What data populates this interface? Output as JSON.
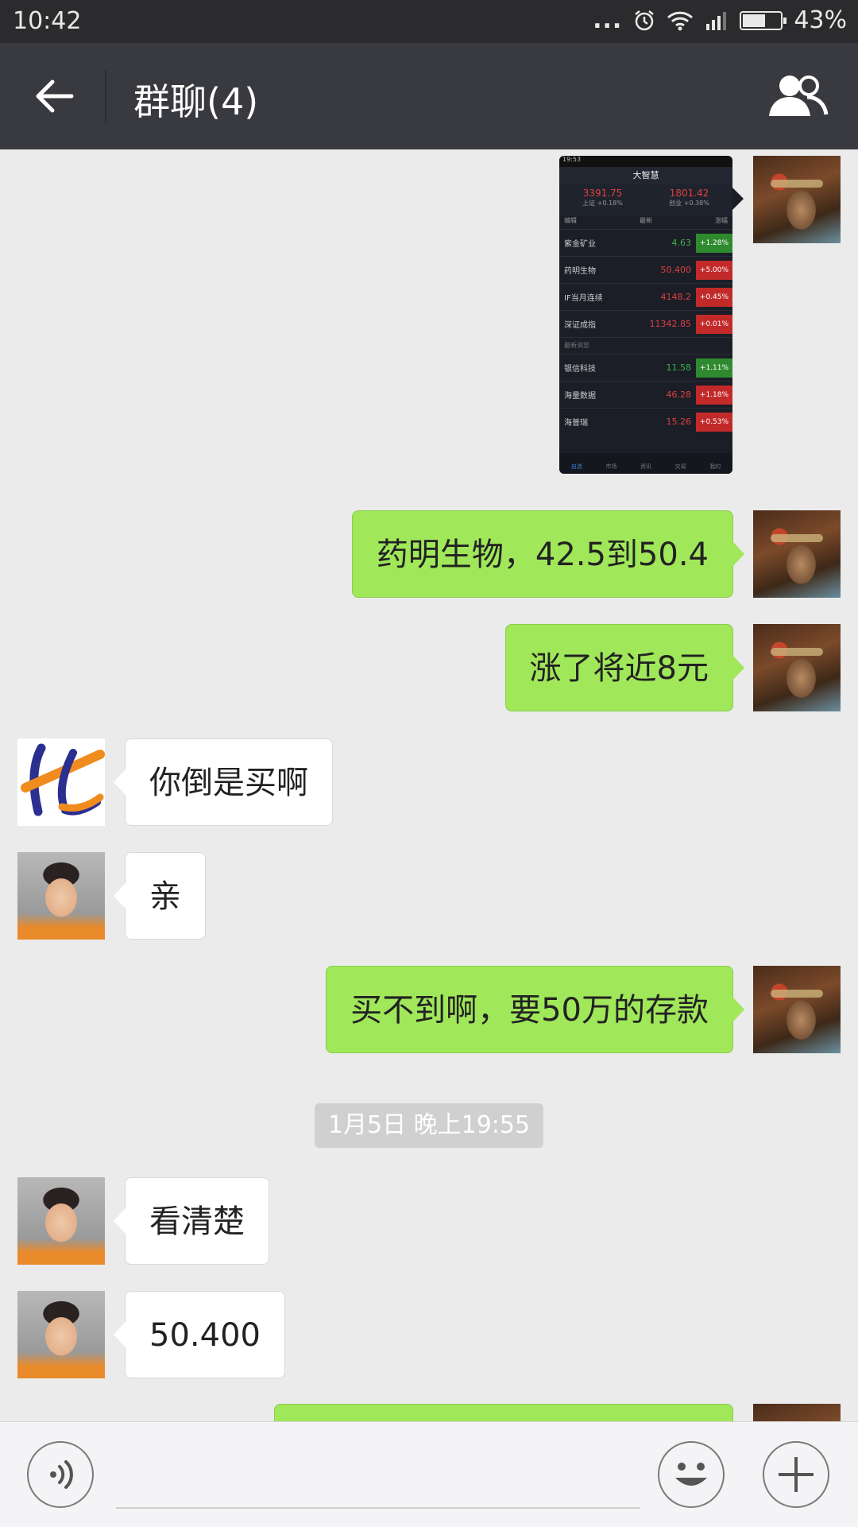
{
  "status_bar": {
    "time": "10:42",
    "more": "...",
    "battery": "43%"
  },
  "header": {
    "title": "群聊(4)"
  },
  "screenshot": {
    "status_time": "19:53",
    "title": "大智慧",
    "index": [
      {
        "value": "3391.75",
        "label": "上证 +0.18%"
      },
      {
        "value": "1801.42",
        "label": "创业 +0.38%"
      }
    ],
    "head": [
      "编辑",
      "最新",
      "涨幅"
    ],
    "rows": [
      {
        "name": "紫金矿业",
        "price": "4.63",
        "change": "+1.28%"
      },
      {
        "name": "药明生物",
        "price": "50.400",
        "change": "+5.00%"
      },
      {
        "name": "IF当月连续",
        "price": "4148.2",
        "change": "+0.45%"
      },
      {
        "name": "深证成指",
        "price": "11342.85",
        "change": "+0.01%"
      }
    ],
    "section": "最新浏览",
    "rows2": [
      {
        "name": "银信科技",
        "price": "11.58",
        "change": "+1.11%"
      },
      {
        "name": "海量数据",
        "price": "46.28",
        "change": "+1.18%"
      },
      {
        "name": "海普瑞",
        "price": "15.26",
        "change": "+0.53%"
      }
    ],
    "tabs": [
      "自选",
      "市场",
      "资讯",
      "交易",
      "我的"
    ]
  },
  "messages": [
    {
      "text": "药明生物，42.5到50.4"
    },
    {
      "text": "涨了将近8元"
    },
    {
      "text": "你倒是买啊"
    },
    {
      "text": "亲"
    },
    {
      "text": "买不到啊，要50万的存款"
    },
    {
      "text": "看清楚"
    },
    {
      "text": "50.400"
    }
  ],
  "timestamp": "1月5日 晚上19:55",
  "colors": {
    "outgoing_bubble": "#a0e75a",
    "incoming_bubble": "#ffffff",
    "nav_bar": "#393a3f",
    "status_bar": "#2b2b2d",
    "chat_bg": "#ebebeb"
  },
  "icons": {
    "back": "arrow-left-icon",
    "group": "group-people-icon",
    "voice": "voice-icon",
    "emoji": "emoji-icon",
    "add": "plus-icon"
  }
}
